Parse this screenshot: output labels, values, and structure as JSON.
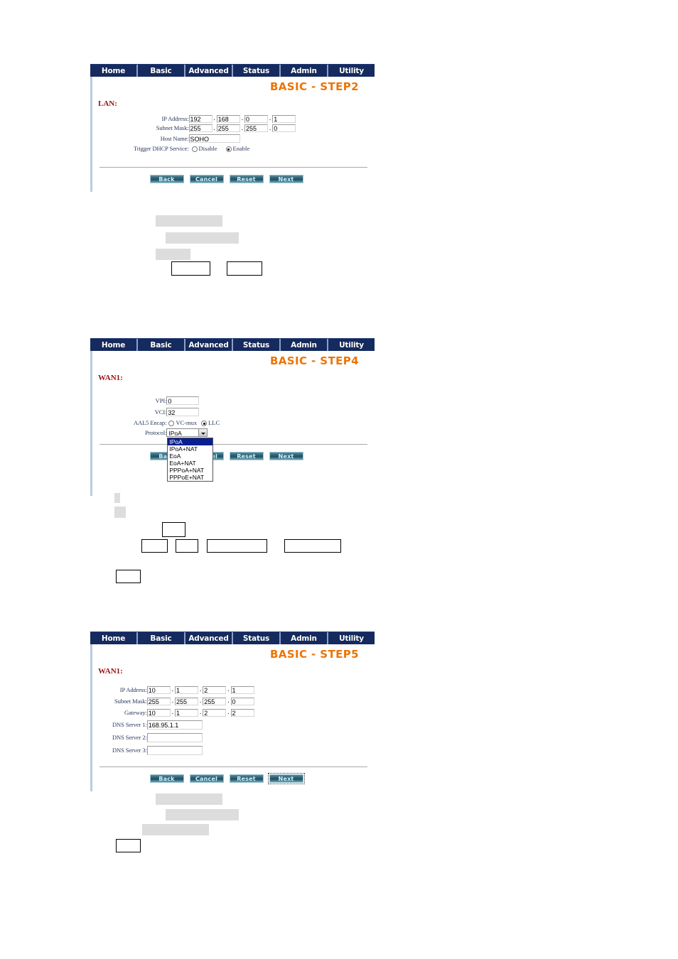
{
  "nav": {
    "items": [
      {
        "label": "Home"
      },
      {
        "label": "Basic"
      },
      {
        "label": "Advanced"
      },
      {
        "label": "Status"
      },
      {
        "label": "Admin"
      },
      {
        "label": "Utility"
      }
    ]
  },
  "colors": {
    "nav_bg": "#16295c",
    "nav_separator": "#8da0c4",
    "title_orange": "#ec7404",
    "section_red": "#9c1012",
    "label_blue": "#2b3a5e",
    "button_face": "#2f6274",
    "button_text": "#cdf3fb",
    "option_highlight": "#0a1f8f",
    "redaction_gray": "#dddddd"
  },
  "buttons": {
    "back": "Back",
    "cancel": "Cancel",
    "reset": "Reset",
    "next": "Next"
  },
  "step2": {
    "title": "BASIC - STEP2",
    "section": "LAN:",
    "fields": {
      "ip_address": {
        "label": "IP Address:",
        "octets": [
          "192",
          "168",
          "0",
          "1"
        ]
      },
      "subnet_mask": {
        "label": "Subnet Mask:",
        "octets": [
          "255",
          "255",
          "255",
          "0"
        ]
      },
      "host_name": {
        "label": "Host Name:",
        "value": "SOHO"
      },
      "dhcp": {
        "label": "Trigger DHCP Service:",
        "options": [
          {
            "label": "Disable",
            "selected": false
          },
          {
            "label": "Enable",
            "selected": true
          }
        ]
      }
    }
  },
  "step4": {
    "title": "BASIC - STEP4",
    "section": "WAN1:",
    "fields": {
      "vpi": {
        "label": "VPI:",
        "value": "0"
      },
      "vci": {
        "label": "VCI:",
        "value": "32"
      },
      "aal5": {
        "label": "AAL5 Encap:",
        "options": [
          {
            "label": "VC-mux",
            "selected": false
          },
          {
            "label": "LLC",
            "selected": true
          }
        ]
      },
      "protocol": {
        "label": "Protocol:",
        "value": "IPoA",
        "open": true,
        "options": [
          {
            "label": "IPoA",
            "selected": true
          },
          {
            "label": "IPoA+NAT",
            "selected": false
          },
          {
            "label": "EoA",
            "selected": false
          },
          {
            "label": "EoA+NAT",
            "selected": false
          },
          {
            "label": "PPPoA+NAT",
            "selected": false
          },
          {
            "label": "PPPoE+NAT",
            "selected": false
          }
        ]
      }
    }
  },
  "step5": {
    "title": "BASIC - STEP5",
    "section": "WAN1:",
    "fields": {
      "ip_address": {
        "label": "IP Address:",
        "octets": [
          "10",
          "1",
          "2",
          "1"
        ]
      },
      "subnet_mask": {
        "label": "Subnet Mask:",
        "octets": [
          "255",
          "255",
          "255",
          "0"
        ]
      },
      "gateway": {
        "label": "Gateway:",
        "octets": [
          "10",
          "1",
          "2",
          "2"
        ]
      },
      "dns1": {
        "label": "DNS Server 1:",
        "value": "168.95.1.1"
      },
      "dns2": {
        "label": "DNS Server 2:",
        "value": ""
      },
      "dns3": {
        "label": "DNS Server 3:",
        "value": ""
      }
    },
    "focused_button": "Next"
  }
}
